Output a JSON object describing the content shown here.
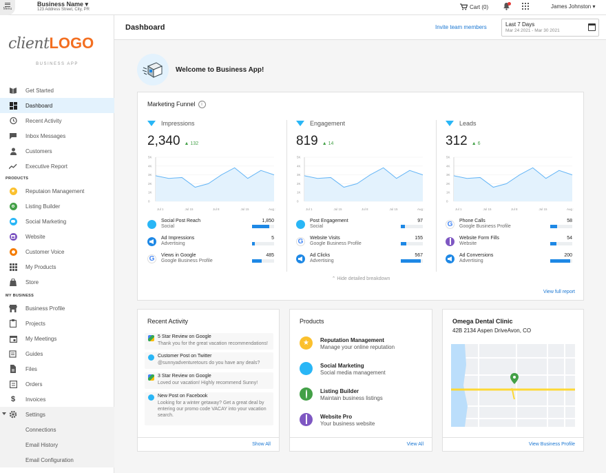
{
  "topbar": {
    "menu_label": "Menu",
    "business_name": "Business Name ▾",
    "business_address": "123 Address Street, City, PR",
    "cart": "Cart (0)",
    "user": "James Johnston ▾"
  },
  "sidebar": {
    "logo_client": "client",
    "logo_brand": "LOGO",
    "app_label": "BUSINESS APP",
    "items": [
      {
        "label": "Get Started",
        "icon": "book-icon"
      },
      {
        "label": "Dashboard",
        "icon": "dashboard-icon"
      },
      {
        "label": "Recent Activity",
        "icon": "history-icon"
      },
      {
        "label": "Inbox Messages",
        "icon": "chat-icon"
      },
      {
        "label": "Customers",
        "icon": "person-icon"
      },
      {
        "label": "Executive Report",
        "icon": "trend-icon"
      }
    ],
    "products_label": "PRODUCTS",
    "products": [
      {
        "label": "Reputaion Management",
        "icon": "star-icon",
        "color": "#fbc02d"
      },
      {
        "label": "Listing Builder",
        "icon": "location-pin-icon",
        "color": "#43a047"
      },
      {
        "label": "Social Marketing",
        "icon": "social-bubble-icon",
        "color": "#29b6f6"
      },
      {
        "label": "Website",
        "icon": "website-icon",
        "color": "#7e57c2"
      },
      {
        "label": "Customer Voice",
        "icon": "customer-voice-icon",
        "color": "#f57c00"
      },
      {
        "label": "My Products",
        "icon": "grid-icon"
      },
      {
        "label": "Store",
        "icon": "store-icon"
      }
    ],
    "business_label": "MY BUSINESS",
    "business": [
      {
        "label": "Business Profile",
        "icon": "storefront-icon"
      },
      {
        "label": "Projects",
        "icon": "clipboard-icon"
      },
      {
        "label": "My Meetings",
        "icon": "calendar-icon"
      },
      {
        "label": "Guides",
        "icon": "book-open-icon"
      },
      {
        "label": "Files",
        "icon": "file-icon"
      },
      {
        "label": "Orders",
        "icon": "list-icon"
      },
      {
        "label": "Invoices",
        "icon": "dollar-icon"
      },
      {
        "label": "Settings",
        "icon": "gear-icon"
      }
    ],
    "settings_sub": [
      {
        "label": "Connections"
      },
      {
        "label": "Email History"
      },
      {
        "label": "Email Configuration"
      }
    ]
  },
  "header": {
    "title": "Dashboard",
    "invite": "Invite team members",
    "date_label": "Last 7 Days",
    "date_value": "Mar 24 2021 - Mar 30 2021"
  },
  "welcome": "Welcome to Business App!",
  "funnel": {
    "title": "Marketing Funnel",
    "columns": [
      {
        "name": "Impressions",
        "value": "2,340",
        "delta": "132",
        "y_ticks": [
          "5K",
          "4K",
          "3K",
          "2K",
          "1K",
          "0"
        ],
        "x_ticks": [
          "Jul 1",
          "Jul 15",
          "Jul 8",
          "Jul 15",
          "Aug 1"
        ],
        "series": [
          2.9,
          2.6,
          2.7,
          1.6,
          2.0,
          3.0,
          3.8,
          2.6,
          3.5,
          3.0
        ],
        "rows": [
          {
            "l1": "Social Post Reach",
            "l2": "Social",
            "value": "1,850",
            "fill": 0.78,
            "icon": "social-bubble-icon",
            "color": "#29b6f6"
          },
          {
            "l1": "Ad Impressions",
            "l2": "Advertising",
            "value": "5",
            "fill": 0.12,
            "icon": "advertising-icon",
            "color": "#1e88e5"
          },
          {
            "l1": "Views in Google",
            "l2": "Google Business Profile",
            "value": "485",
            "fill": 0.45,
            "icon": "google-icon",
            "color": "#ffffff"
          }
        ]
      },
      {
        "name": "Engagement",
        "value": "819",
        "delta": "14",
        "y_ticks": [
          "5K",
          "4K",
          "3K",
          "2K",
          "1K",
          "0"
        ],
        "x_ticks": [
          "Jul 1",
          "Jul 15",
          "Jul 8",
          "Jul 15",
          "Aug 1"
        ],
        "series": [
          2.9,
          2.6,
          2.7,
          1.6,
          2.0,
          3.0,
          3.8,
          2.6,
          3.5,
          3.0
        ],
        "rows": [
          {
            "l1": "Post Engagement",
            "l2": "Social",
            "value": "97",
            "fill": 0.18,
            "icon": "social-bubble-icon",
            "color": "#29b6f6"
          },
          {
            "l1": "Website Visits",
            "l2": "Google Business Profile",
            "value": "155",
            "fill": 0.25,
            "icon": "google-icon",
            "color": "#ffffff"
          },
          {
            "l1": "Ad Clicks",
            "l2": "Advertising",
            "value": "567",
            "fill": 0.92,
            "icon": "advertising-icon",
            "color": "#1e88e5"
          }
        ]
      },
      {
        "name": "Leads",
        "value": "312",
        "delta": "6",
        "y_ticks": [
          "5K",
          "4K",
          "3K",
          "2K",
          "1K",
          "0"
        ],
        "x_ticks": [
          "Jul 1",
          "Jul 15",
          "Jul 8",
          "Jul 15",
          "Aug 1"
        ],
        "series": [
          2.9,
          2.6,
          2.7,
          1.6,
          2.0,
          3.0,
          3.8,
          2.6,
          3.5,
          3.0
        ],
        "rows": [
          {
            "l1": "Phone Calls",
            "l2": "Google Business Profile",
            "value": "58",
            "fill": 0.3,
            "icon": "google-icon",
            "color": "#ffffff"
          },
          {
            "l1": "Website Form Fills",
            "l2": "Website",
            "value": "54",
            "fill": 0.28,
            "icon": "website-icon",
            "color": "#7e57c2"
          },
          {
            "l1": "Ad Conversions",
            "l2": "Advertising",
            "value": "200",
            "fill": 0.9,
            "icon": "advertising-icon",
            "color": "#1e88e5"
          }
        ]
      }
    ],
    "hide_label": "Hide detailed breakdown",
    "view_full": "View full report"
  },
  "recent_activity": {
    "title": "Recent Activity",
    "items": [
      {
        "title": "5 Star Review on Google",
        "body": "Thank you for the great vacation recommendations!",
        "icon": "google-review-icon"
      },
      {
        "title": "Customer Post on Twitter",
        "body": "@sunnyadventuretours do you have any deals?",
        "icon": "social-bubble-icon"
      },
      {
        "title": "3 Star Review on Google",
        "body": "Loved our vacation! Highly recommend Sunny!",
        "icon": "google-review-icon"
      },
      {
        "title": "New Post on Facebook",
        "body": "Looking for a winter getaway? Get a great deal by entering our promo code VACAY into your vacation search.",
        "icon": "social-bubble-icon"
      }
    ],
    "link": "Show All"
  },
  "products": {
    "title": "Products",
    "items": [
      {
        "name": "Reputation Management",
        "desc": "Manage your online reputation",
        "icon": "star-icon",
        "color": "#fbc02d"
      },
      {
        "name": "Social Marketing",
        "desc": "Social media management",
        "icon": "social-bubble-icon",
        "color": "#29b6f6"
      },
      {
        "name": "Listing Builder",
        "desc": "Maintain business listings",
        "icon": "location-pin-icon",
        "color": "#43a047"
      },
      {
        "name": "Website Pro",
        "desc": "Your business website",
        "icon": "website-icon",
        "color": "#7e57c2"
      }
    ],
    "link": "View All"
  },
  "clinic": {
    "name": "Omega Dental Clinic",
    "address": "42B 2134 Aspen DriveAvon, CO",
    "link": "View Business Profile"
  }
}
